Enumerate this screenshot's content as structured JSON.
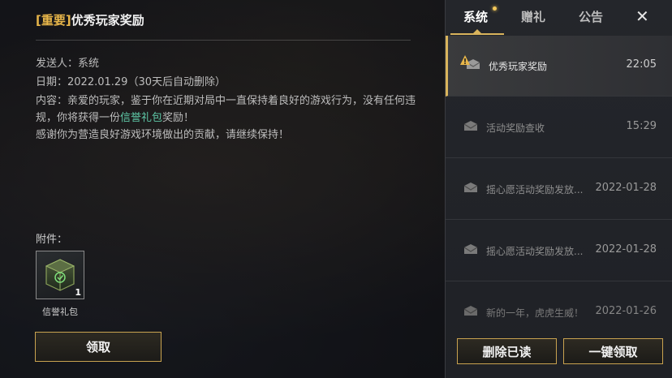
{
  "detail": {
    "title_tag": "[重要]",
    "title_text": "优秀玩家奖励",
    "sender_label": "发送人：",
    "sender_value": "系统",
    "date_label": "日期：",
    "date_value": "2022.01.29（30天后自动删除）",
    "content_label": "内容：",
    "content_line1": "亲爱的玩家，鉴于你在近期对局中一直保持着良好的游戏行为，没有任何违规，你将获得一份",
    "content_highlight": "信誉礼包",
    "content_line1_end": "奖励！",
    "content_line2": "感谢你为营造良好游戏环境做出的贡献，请继续保持！",
    "attachment_label": "附件：",
    "attachment": {
      "name": "信誉礼包",
      "count": "1"
    },
    "claim_label": "领取"
  },
  "panel": {
    "tabs": [
      {
        "label": "系统",
        "active": true
      },
      {
        "label": "赠礼",
        "active": false
      },
      {
        "label": "公告",
        "active": false
      }
    ],
    "close_label": "✕",
    "mails": [
      {
        "subject": "优秀玩家奖励",
        "time": "22:05",
        "active": true,
        "important": true
      },
      {
        "subject": "活动奖励查收",
        "time": "15:29",
        "active": false,
        "important": false
      },
      {
        "subject": "摇心愿活动奖励发放...",
        "time": "2022-01-28",
        "active": false,
        "important": false
      },
      {
        "subject": "摇心愿活动奖励发放...",
        "time": "2022-01-28",
        "active": false,
        "important": false
      },
      {
        "subject": "新的一年，虎虎生威！",
        "time": "2022-01-26",
        "active": false,
        "important": false
      }
    ],
    "delete_read_label": "删除已读",
    "claim_all_label": "一键领取"
  },
  "colors": {
    "accent_gold": "#d9b45c",
    "tag_gold": "#e8b64a",
    "highlight_green": "#5fc9a8"
  }
}
